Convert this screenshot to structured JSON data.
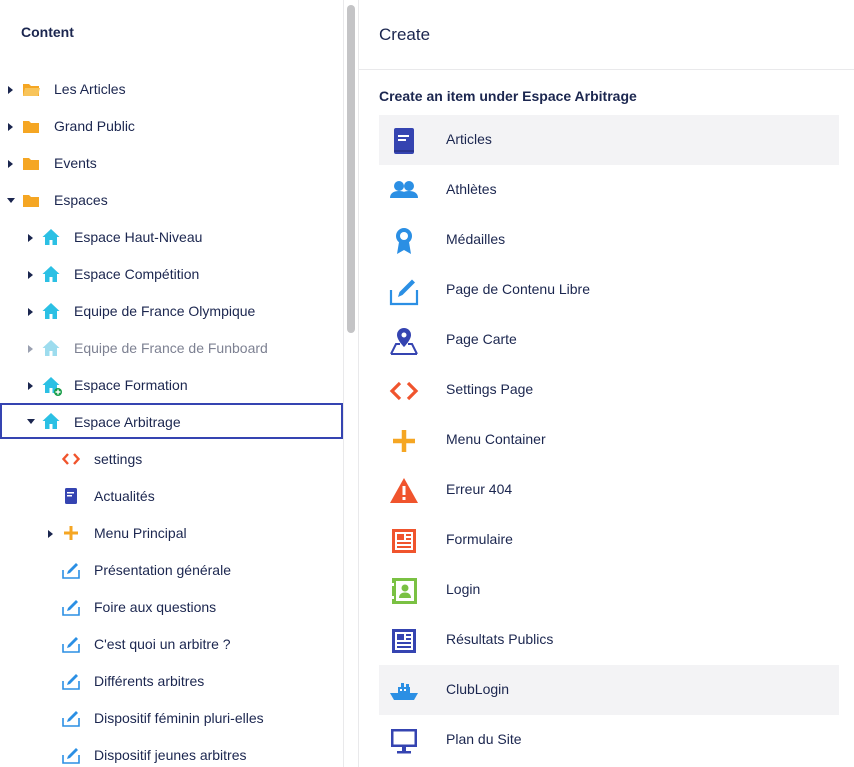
{
  "tree": {
    "title": "Content",
    "items": [
      {
        "label": "Les Articles"
      },
      {
        "label": "Grand Public"
      },
      {
        "label": "Events"
      },
      {
        "label": "Espaces"
      },
      {
        "label": "Espace Haut-Niveau"
      },
      {
        "label": "Espace Compétition"
      },
      {
        "label": "Equipe de France Olympique"
      },
      {
        "label": "Equipe de France de Funboard"
      },
      {
        "label": "Espace Formation"
      },
      {
        "label": "Espace Arbitrage"
      },
      {
        "label": "settings"
      },
      {
        "label": "Actualités"
      },
      {
        "label": "Menu Principal"
      },
      {
        "label": "Présentation générale"
      },
      {
        "label": "Foire aux questions"
      },
      {
        "label": "C'est quoi un arbitre ?"
      },
      {
        "label": "Différents arbitres"
      },
      {
        "label": "Dispositif féminin pluri-elles"
      },
      {
        "label": "Dispositif jeunes arbitres"
      }
    ]
  },
  "create": {
    "title": "Create",
    "subtitle": "Create an item under Espace Arbitrage",
    "items": [
      {
        "label": "Articles",
        "icon": "book-icon"
      },
      {
        "label": "Athlètes",
        "icon": "users-icon"
      },
      {
        "label": "Médailles",
        "icon": "medal-icon"
      },
      {
        "label": "Page de Contenu Libre",
        "icon": "edit-icon"
      },
      {
        "label": "Page Carte",
        "icon": "map-pin-icon"
      },
      {
        "label": "Settings Page",
        "icon": "code-icon"
      },
      {
        "label": "Menu Container",
        "icon": "plus-icon"
      },
      {
        "label": "Erreur 404",
        "icon": "warning-icon"
      },
      {
        "label": "Formulaire",
        "icon": "newspaper-icon"
      },
      {
        "label": "Login",
        "icon": "contact-book-icon"
      },
      {
        "label": "Résultats Publics",
        "icon": "newspaper-icon"
      },
      {
        "label": "ClubLogin",
        "icon": "ship-icon"
      },
      {
        "label": "Plan du Site",
        "icon": "monitor-icon"
      }
    ]
  },
  "colors": {
    "navy": "#1b264f",
    "folder": "#f5a623",
    "house": "#2bc0e4",
    "indigo": "#3544b1",
    "orange_red": "#f0542d",
    "orange": "#f5a623",
    "green": "#7ac143",
    "highlight": "#f3f3f5"
  }
}
